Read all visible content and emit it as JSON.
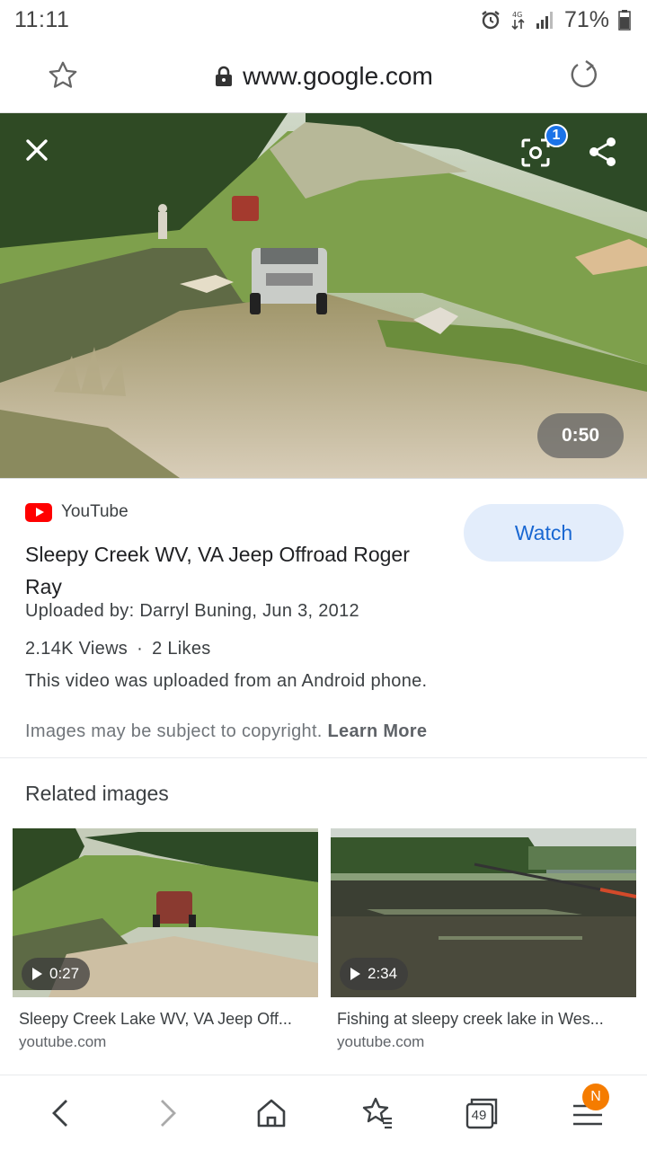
{
  "status_bar": {
    "time": "11:11",
    "battery": "71%"
  },
  "url_bar": {
    "domain": "www.google.com"
  },
  "hero": {
    "duration": "0:50",
    "lens_badge_count": "1"
  },
  "result": {
    "source": "YouTube",
    "watch_label": "Watch",
    "title": "Sleepy Creek WV, VA Jeep Offroad Roger Ray",
    "uploaded": "Uploaded by: Darryl Buning, Jun 3, 2012",
    "views": "2.14K Views",
    "separator": "·",
    "likes": "2 Likes",
    "description": "This video was uploaded from an Android phone.",
    "copyright_text": "Images may be subject to copyright.",
    "learn_more": "Learn More"
  },
  "related": {
    "heading": "Related images",
    "items": [
      {
        "duration": "0:27",
        "title": "Sleepy Creek Lake WV, VA Jeep Off...",
        "domain": "youtube.com"
      },
      {
        "duration": "2:34",
        "title": "Fishing at sleepy creek lake in Wes...",
        "domain": "youtube.com"
      }
    ]
  },
  "bottom_nav": {
    "tabs_count": "49",
    "menu_badge": "N"
  },
  "colors": {
    "accent": "#1967d2",
    "youtube_red": "#ff0000",
    "watch_bg": "#e3edfb",
    "badge_orange": "#f57c00"
  }
}
